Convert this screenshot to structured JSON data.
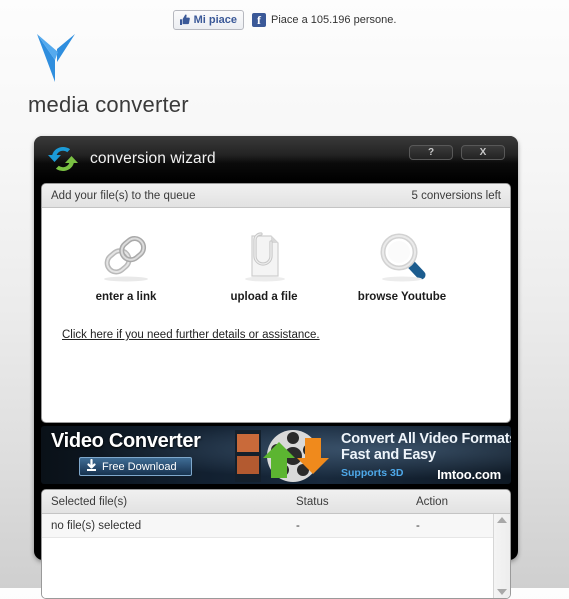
{
  "social": {
    "like_label": "Mi piace",
    "count_text": "Piace a 105.196 persone.",
    "thumb_icon": "thumbs-up-icon",
    "facebook_icon": "facebook-f-icon",
    "brand_color": "#3b5998"
  },
  "brand": {
    "name": "media converter",
    "logo_icon": "media-converter-logo",
    "logo_color": "#2f8ede"
  },
  "window": {
    "title": "conversion wizard",
    "icon": "convert-arrows-icon",
    "help_label": "?",
    "close_label": "X"
  },
  "queue_panel": {
    "heading": "Add your file(s) to the queue",
    "conversions_left": "5 conversions left",
    "actions": [
      {
        "label": "enter a link",
        "icon": "chain-link-icon"
      },
      {
        "label": "upload a file",
        "icon": "document-paperclip-icon"
      },
      {
        "label": "browse Youtube",
        "icon": "magnifier-icon"
      }
    ],
    "help_link": "Click here if you need further details or assistance."
  },
  "banner": {
    "title": "Video Converter",
    "download_label": "Free Download",
    "download_icon": "download-arrow-icon",
    "headline_line1": "Convert All Video Formats",
    "headline_line2": "Fast and Easy",
    "supports": "Supports 3D",
    "site": "Imtoo.com",
    "accent_color": "#4ea8e8"
  },
  "file_table": {
    "columns": [
      "Selected file(s)",
      "Status",
      "Action"
    ],
    "rows": [
      {
        "file": "no file(s) selected",
        "status": "-",
        "action": "-"
      }
    ],
    "scroll_up_icon": "scroll-up-arrow-icon",
    "scroll_down_icon": "scroll-down-arrow-icon"
  }
}
